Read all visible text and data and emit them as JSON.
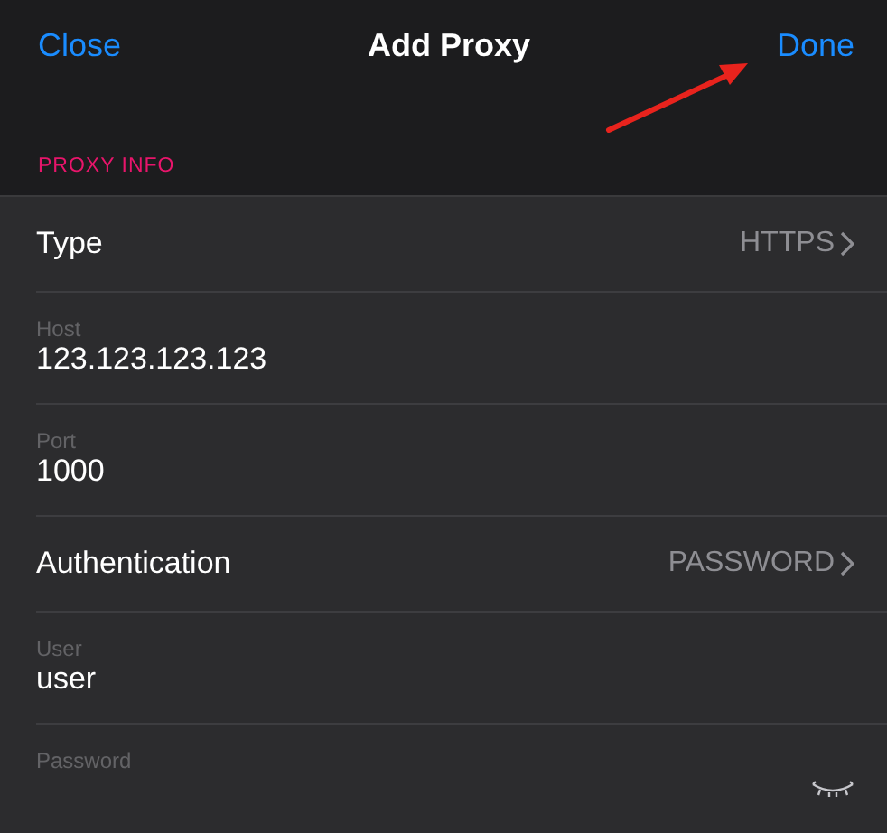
{
  "nav": {
    "left": "Close",
    "title": "Add Proxy",
    "right": "Done"
  },
  "section": "PROXY INFO",
  "rows": [
    {
      "kind": "select",
      "label": "Type",
      "value": "HTTPS"
    },
    {
      "kind": "field",
      "label": "Host",
      "value": "123.123.123.123"
    },
    {
      "kind": "field",
      "label": "Port",
      "value": "1000"
    },
    {
      "kind": "select",
      "label": "Authentication",
      "value": "PASSWORD"
    },
    {
      "kind": "field",
      "label": "User",
      "value": "user"
    },
    {
      "kind": "secret",
      "label": "Password"
    }
  ]
}
